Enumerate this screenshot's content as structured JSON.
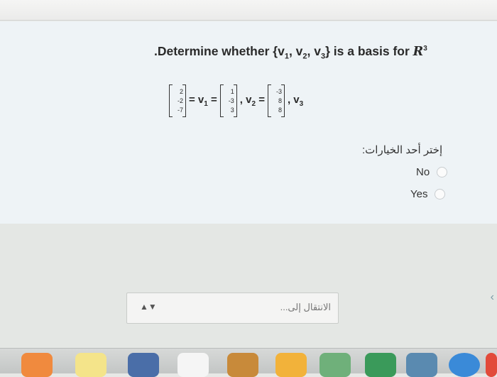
{
  "question": {
    "prefix": ".Determine whether {v",
    "sub1": "1",
    "sep1": ", v",
    "sub2": "2",
    "sep2": ", v",
    "sub3": "3",
    "suffix": "} is a basis for ",
    "space_symbol": "R",
    "space_exponent": "3"
  },
  "equation": {
    "target_vector": [
      "2",
      "-2",
      "-7"
    ],
    "eq1": "= v",
    "eq1_sub": "1",
    "eq1_after": "=",
    "v1": [
      "1",
      "-3",
      "3"
    ],
    "eq2": ", v",
    "eq2_sub": "2",
    "eq2_after": "=",
    "v2": [
      "-3",
      "8",
      "8"
    ],
    "eq3": ", v",
    "eq3_sub": "3"
  },
  "choose_prompt": "إختر أحد الخيارات:",
  "options": [
    {
      "label": "No"
    },
    {
      "label": "Yes"
    }
  ],
  "navigation": {
    "arrow_icon": "up-down-arrows-icon",
    "placeholder": "الانتقال إلى..."
  },
  "dock": {
    "icons": [
      {
        "name": "app-icon-1",
        "color": "#f08a3e"
      },
      {
        "name": "notes-icon",
        "color": "#f4e48a"
      },
      {
        "name": "launchpad-icon",
        "color": "#4a6ea8"
      },
      {
        "name": "calendar-icon",
        "color": "#f5f5f5"
      },
      {
        "name": "notes-folder-icon",
        "color": "#c88a3a"
      },
      {
        "name": "photos-icon",
        "color": "#f2b23a"
      },
      {
        "name": "maps-icon",
        "color": "#6fb07a"
      },
      {
        "name": "facetime-icon",
        "color": "#3a9a5a"
      },
      {
        "name": "preview-icon",
        "color": "#5a8ab0"
      },
      {
        "name": "safari-icon",
        "color": "#3a8ad8"
      },
      {
        "name": "app-icon-last",
        "color": "#e24a3a"
      }
    ]
  }
}
